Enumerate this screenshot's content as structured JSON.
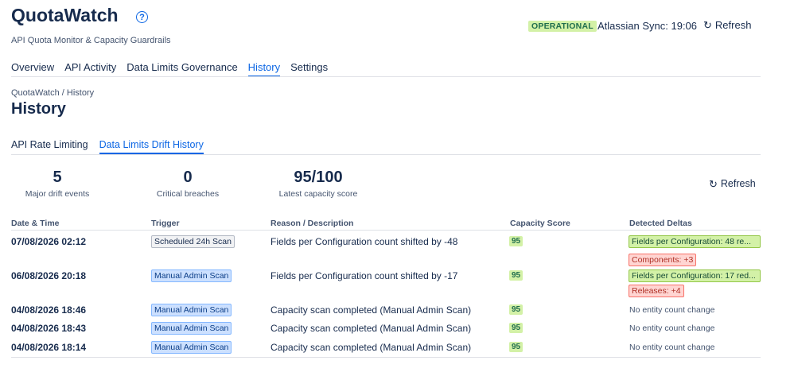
{
  "app": {
    "title": "QuotaWatch",
    "help_glyph": "?",
    "subtitle": "API Quota Monitor & Capacity Guardrails",
    "status": "OPERATIONAL",
    "sync_text": "Atlassian Sync: 19:06",
    "refresh_label": "Refresh",
    "status_color": "#d3f1a7",
    "accent_color": "#0c66e4"
  },
  "nav": {
    "items": [
      "Overview",
      "API Activity",
      "Data Limits Governance",
      "History",
      "Settings"
    ],
    "active": "History"
  },
  "breadcrumb": "QuotaWatch / History",
  "page_title": "History",
  "sub_tabs": {
    "items": [
      "API Rate Limiting",
      "Data Limits Drift History"
    ],
    "active": "Data Limits Drift History"
  },
  "stats": [
    {
      "value": "5",
      "label": "Major drift events"
    },
    {
      "value": "0",
      "label": "Critical breaches"
    },
    {
      "value": "95/100",
      "label": "Latest capacity score"
    }
  ],
  "stats_refresh_label": "Refresh",
  "table": {
    "headers": [
      "Date & Time",
      "Trigger",
      "Reason / Description",
      "Capacity Score",
      "Detected Deltas"
    ],
    "rows": [
      {
        "date": "07/08/2026 02:12",
        "trigger": "Scheduled 24h Scan",
        "reason": "Fields per Configuration count shifted by -48",
        "score": "95",
        "deltas": [
          {
            "text": "Fields per Configuration: 48 re...",
            "tone": "green"
          },
          {
            "text": "Components: +3",
            "tone": "red"
          }
        ],
        "no_change": ""
      },
      {
        "date": "06/08/2026 20:18",
        "trigger": "Manual Admin Scan",
        "reason": "Fields per Configuration count shifted by -17",
        "score": "95",
        "deltas": [
          {
            "text": "Fields per Configuration: 17 red...",
            "tone": "green"
          },
          {
            "text": "Releases: +4",
            "tone": "red"
          }
        ],
        "no_change": ""
      },
      {
        "date": "04/08/2026 18:46",
        "trigger": "Manual Admin Scan",
        "reason": "Capacity scan completed (Manual Admin Scan)",
        "score": "95",
        "deltas": [],
        "no_change": "No entity count change"
      },
      {
        "date": "04/08/2026 18:43",
        "trigger": "Manual Admin Scan",
        "reason": "Capacity scan completed (Manual Admin Scan)",
        "score": "95",
        "deltas": [],
        "no_change": "No entity count change"
      },
      {
        "date": "04/08/2026 18:14",
        "trigger": "Manual Admin Scan",
        "reason": "Capacity scan completed (Manual Admin Scan)",
        "score": "95",
        "deltas": [],
        "no_change": "No entity count change"
      }
    ]
  }
}
